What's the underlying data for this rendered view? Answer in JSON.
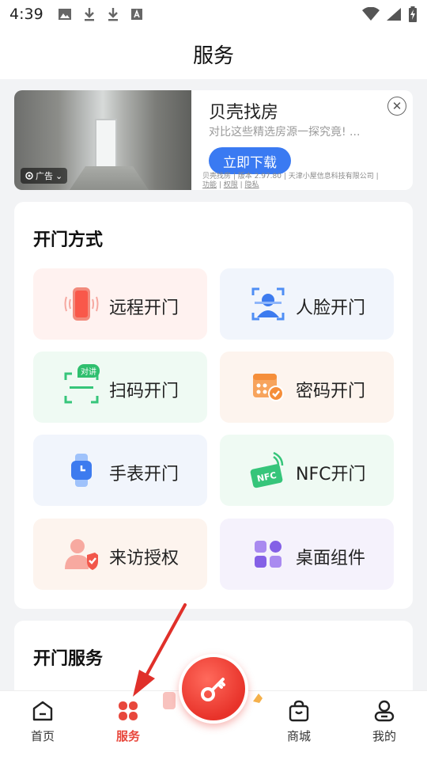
{
  "status_bar": {
    "time": "4:39",
    "icons": [
      "image-icon",
      "download-icon",
      "download-icon",
      "font-icon",
      "wifi-icon",
      "signal-icon",
      "battery-charging-icon"
    ]
  },
  "header": {
    "title": "服务"
  },
  "ad": {
    "badge": "广告",
    "title": "贝壳找房",
    "subtitle": "对比这些精选房源一探究竟! ...",
    "button": "立即下载",
    "fine_print_main": "贝壳找房 | 版本 2.97.80 | 天津小屋信息科技有限公司 |",
    "link_function": "功能",
    "link_permission": "权限",
    "link_privacy": "隐私"
  },
  "door_methods": {
    "title": "开门方式",
    "items": [
      {
        "label": "远程开门",
        "icon": "phone-vibrate-icon"
      },
      {
        "label": "人脸开门",
        "icon": "face-scan-icon"
      },
      {
        "label": "扫码开门",
        "icon": "qr-scan-icon",
        "tag": "对讲"
      },
      {
        "label": "密码开门",
        "icon": "password-keypad-icon"
      },
      {
        "label": "手表开门",
        "icon": "smartwatch-icon"
      },
      {
        "label": "NFC开门",
        "icon": "nfc-card-icon"
      },
      {
        "label": "来访授权",
        "icon": "visitor-auth-icon"
      },
      {
        "label": "桌面组件",
        "icon": "widget-icon"
      }
    ]
  },
  "door_service": {
    "title": "开门服务"
  },
  "bottom_nav": {
    "items": [
      {
        "label": "首页",
        "icon": "home-icon"
      },
      {
        "label": "服务",
        "icon": "service-icon",
        "active": true
      },
      {
        "label": "商城",
        "icon": "shop-bag-icon"
      },
      {
        "label": "我的",
        "icon": "profile-icon"
      }
    ],
    "fab_icon": "key-icon"
  },
  "colors": {
    "accent": "#e8473c",
    "ad_button": "#3a7af2",
    "annotation_arrow": "#e0302a"
  }
}
